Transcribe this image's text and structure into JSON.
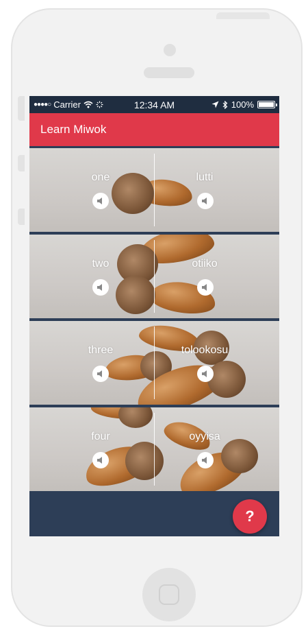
{
  "status_bar": {
    "signal": "●●●●○",
    "carrier": "Carrier",
    "time": "12:34 AM",
    "battery": "100%",
    "battery_level": 1.0
  },
  "app_bar": {
    "title": "Learn Miwok"
  },
  "numbers": [
    {
      "default": "one",
      "miwok": "lutti"
    },
    {
      "default": "two",
      "miwok": "otiiko"
    },
    {
      "default": "three",
      "miwok": "tolookosu"
    },
    {
      "default": "four",
      "miwok": "oyyisa"
    }
  ],
  "fab": {
    "label": "?"
  },
  "colors": {
    "accent": "#e0394a",
    "screen_background": "#2d3e57",
    "status_bar": "#1f2d40"
  },
  "icons": {
    "audio": "speaker-icon",
    "wifi": "wifi-icon",
    "location": "location-arrow-icon",
    "bluetooth": "bluetooth-icon",
    "battery": "battery-icon"
  }
}
